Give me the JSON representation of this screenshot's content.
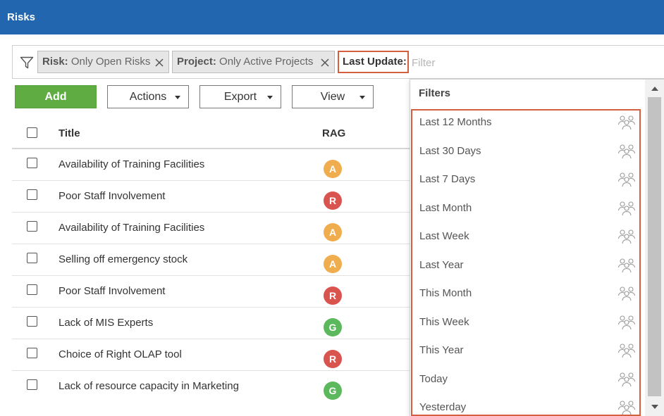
{
  "window": {
    "title": "Risks"
  },
  "filter_bar": {
    "chips": [
      {
        "key": "Risk:",
        "value": "Only Open Risks"
      },
      {
        "key": "Project:",
        "value": "Only Active Projects"
      }
    ],
    "active_field": "Last Update:",
    "input_placeholder": "Filter"
  },
  "toolbar": {
    "add_label": "Add",
    "actions_label": "Actions",
    "export_label": "Export",
    "view_label": "View"
  },
  "table": {
    "headers": {
      "title": "Title",
      "rag": "RAG"
    },
    "rows": [
      {
        "title": "Availability of Training Facilities",
        "rag": "A"
      },
      {
        "title": "Poor Staff Involvement",
        "rag": "R"
      },
      {
        "title": "Availability of Training Facilities",
        "rag": "A"
      },
      {
        "title": "Selling off emergency stock",
        "rag": "A"
      },
      {
        "title": "Poor Staff Involvement",
        "rag": "R"
      },
      {
        "title": "Lack of MIS Experts",
        "rag": "G"
      },
      {
        "title": "Choice of Right OLAP tool",
        "rag": "R"
      },
      {
        "title": "Lack of resource capacity in Marketing",
        "rag": "G"
      }
    ]
  },
  "rag_colors": {
    "A": "#f0ad4e",
    "R": "#d9534f",
    "G": "#5cb85c"
  },
  "dropdown": {
    "header": "Filters",
    "items": [
      "Last 12 Months",
      "Last 30 Days",
      "Last 7 Days",
      "Last Month",
      "Last Week",
      "Last Year",
      "This Month",
      "This Week",
      "This Year",
      "Today",
      "Yesterday"
    ],
    "item_icon": "group-icon"
  },
  "colors": {
    "header_blue": "#2166ae",
    "add_green": "#5fac43",
    "highlight_red": "#d35f3f"
  }
}
